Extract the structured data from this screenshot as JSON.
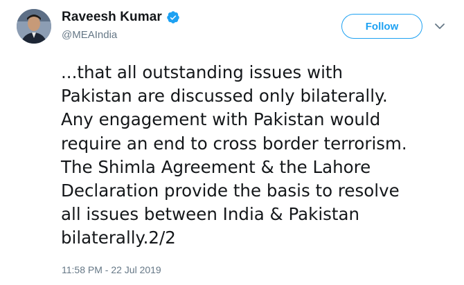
{
  "author": {
    "display_name": "Raveesh Kumar",
    "handle": "@MEAIndia",
    "verified": true,
    "avatar_icon": "profile-photo"
  },
  "follow_button": {
    "label": "Follow"
  },
  "caret_icon": "chevron-down-icon",
  "tweet": {
    "text": "...that all outstanding issues with\nPakistan are discussed only bilaterally.\nAny engagement with Pakistan would\nrequire an end to cross border terrorism.\nThe Shimla Agreement & the Lahore\nDeclaration provide the basis to resolve\nall issues between India & Pakistan\nbilaterally.2/2",
    "timestamp": "11:58 PM - 22 Jul 2019"
  },
  "colors": {
    "accent": "#1da1f2",
    "text_primary": "#14171a",
    "text_secondary": "#657786"
  }
}
